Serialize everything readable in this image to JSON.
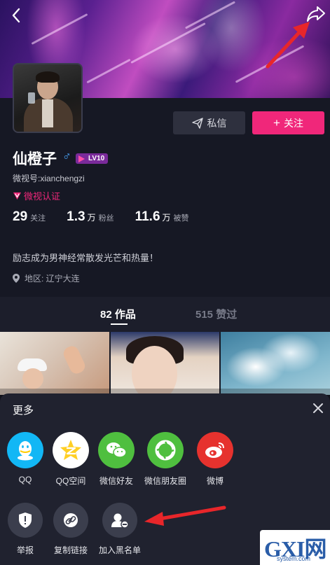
{
  "profile": {
    "name": "仙橙子",
    "gender_symbol": "♂",
    "level": "LV10",
    "weishi_id": "微视号:xianchengzi",
    "verified_label": "微视认证",
    "bio": "励志成为男神经常散发光芒和热量！",
    "location": "地区: 辽宁大连"
  },
  "buttons": {
    "message": "私信",
    "follow": "关注"
  },
  "stats": [
    {
      "value": "29",
      "unit": "",
      "label": "关注"
    },
    {
      "value": "1.3",
      "unit": "万",
      "label": "粉丝"
    },
    {
      "value": "11.6",
      "unit": "万",
      "label": "被赞"
    }
  ],
  "tabs": {
    "works": "82 作品",
    "liked": "515 赞过"
  },
  "sheet": {
    "title": "更多",
    "share_targets": [
      {
        "label": "QQ",
        "icon": "qq-icon",
        "color": "#12b7f5"
      },
      {
        "label": "QQ空间",
        "icon": "qzone-icon",
        "color": "#ffffff"
      },
      {
        "label": "微信好友",
        "icon": "wechat-icon",
        "color": "#4fbf3f"
      },
      {
        "label": "微信朋友圈",
        "icon": "moments-icon",
        "color": "#4fbf3f"
      },
      {
        "label": "微博",
        "icon": "weibo-icon",
        "color": "#e6322e"
      }
    ],
    "actions": [
      {
        "label": "举报",
        "icon": "report-shield-icon"
      },
      {
        "label": "复制链接",
        "icon": "link-icon"
      },
      {
        "label": "加入黑名单",
        "icon": "blacklist-user-icon"
      }
    ]
  },
  "watermark": {
    "main": "GXI网",
    "sub": "system.com"
  },
  "colors": {
    "accent": "#f0277a",
    "background": "#161824",
    "annotation_arrow": "#e8262a"
  }
}
